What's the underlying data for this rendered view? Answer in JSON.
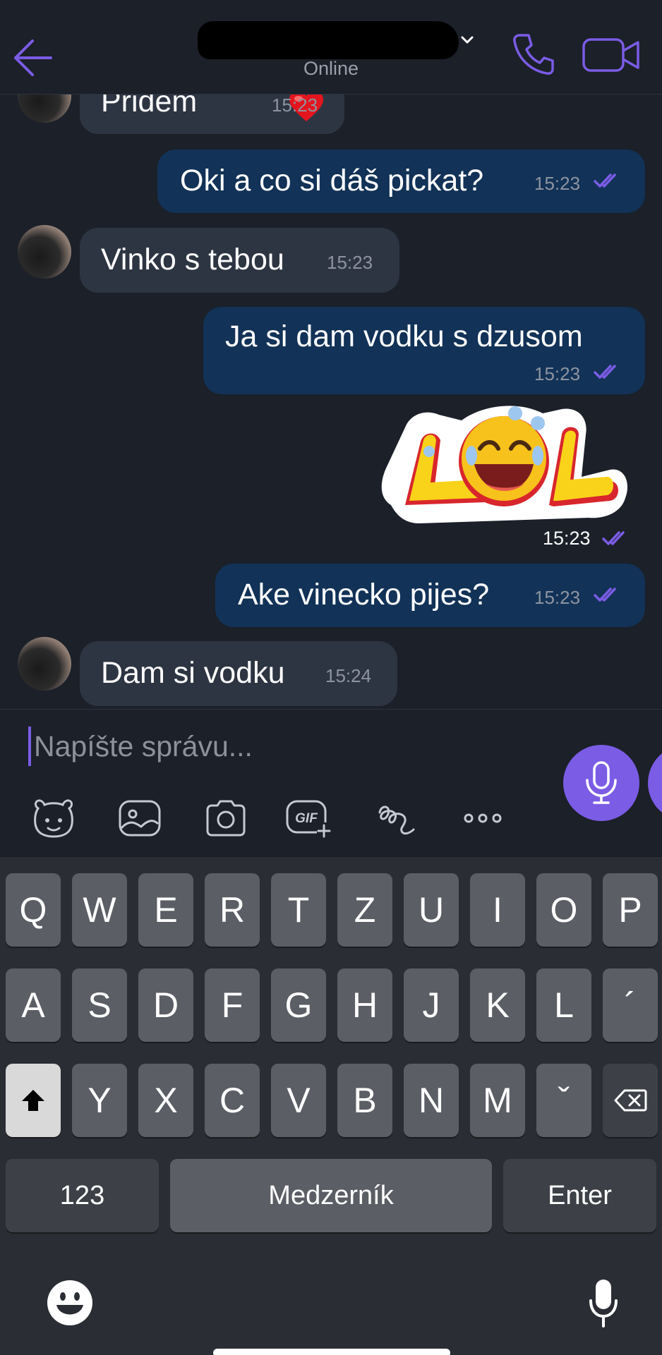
{
  "header": {
    "status": "Online"
  },
  "messages": [
    {
      "direction": "in",
      "text": "Pridem",
      "time": "15:23"
    },
    {
      "direction": "out",
      "text": "Oki a co si dáš pickat?",
      "time": "15:23"
    },
    {
      "direction": "in",
      "text": "Vinko s tebou",
      "time": "15:23"
    },
    {
      "direction": "out",
      "text": "Ja si dam vodku s dzusom",
      "time": "15:23"
    },
    {
      "direction": "out",
      "sticker": "lol-sticker",
      "time": "15:23"
    },
    {
      "direction": "out",
      "text": "Ake vinecko pijes?",
      "time": "15:23"
    },
    {
      "direction": "in",
      "text": "Dam si vodku",
      "time": "15:24"
    }
  ],
  "composer": {
    "placeholder": "Napíšte správu...",
    "toolbar_icons": [
      "sticker-icon",
      "gallery-icon",
      "camera-icon",
      "gif-icon",
      "doodle-icon",
      "more-icon"
    ]
  },
  "keyboard": {
    "row1": [
      "Q",
      "W",
      "E",
      "R",
      "T",
      "Z",
      "U",
      "I",
      "O",
      "P"
    ],
    "row2": [
      "A",
      "S",
      "D",
      "F",
      "G",
      "H",
      "J",
      "K",
      "L",
      "´"
    ],
    "row3": [
      "Y",
      "X",
      "C",
      "V",
      "B",
      "N",
      "M",
      "ˇ"
    ],
    "numbers_label": "123",
    "space_label": "Medzerník",
    "enter_label": "Enter"
  },
  "colors": {
    "accent": "#7b5ce5",
    "incoming_bubble": "#2e3542",
    "outgoing_bubble": "#123257",
    "background": "#1b2029"
  }
}
